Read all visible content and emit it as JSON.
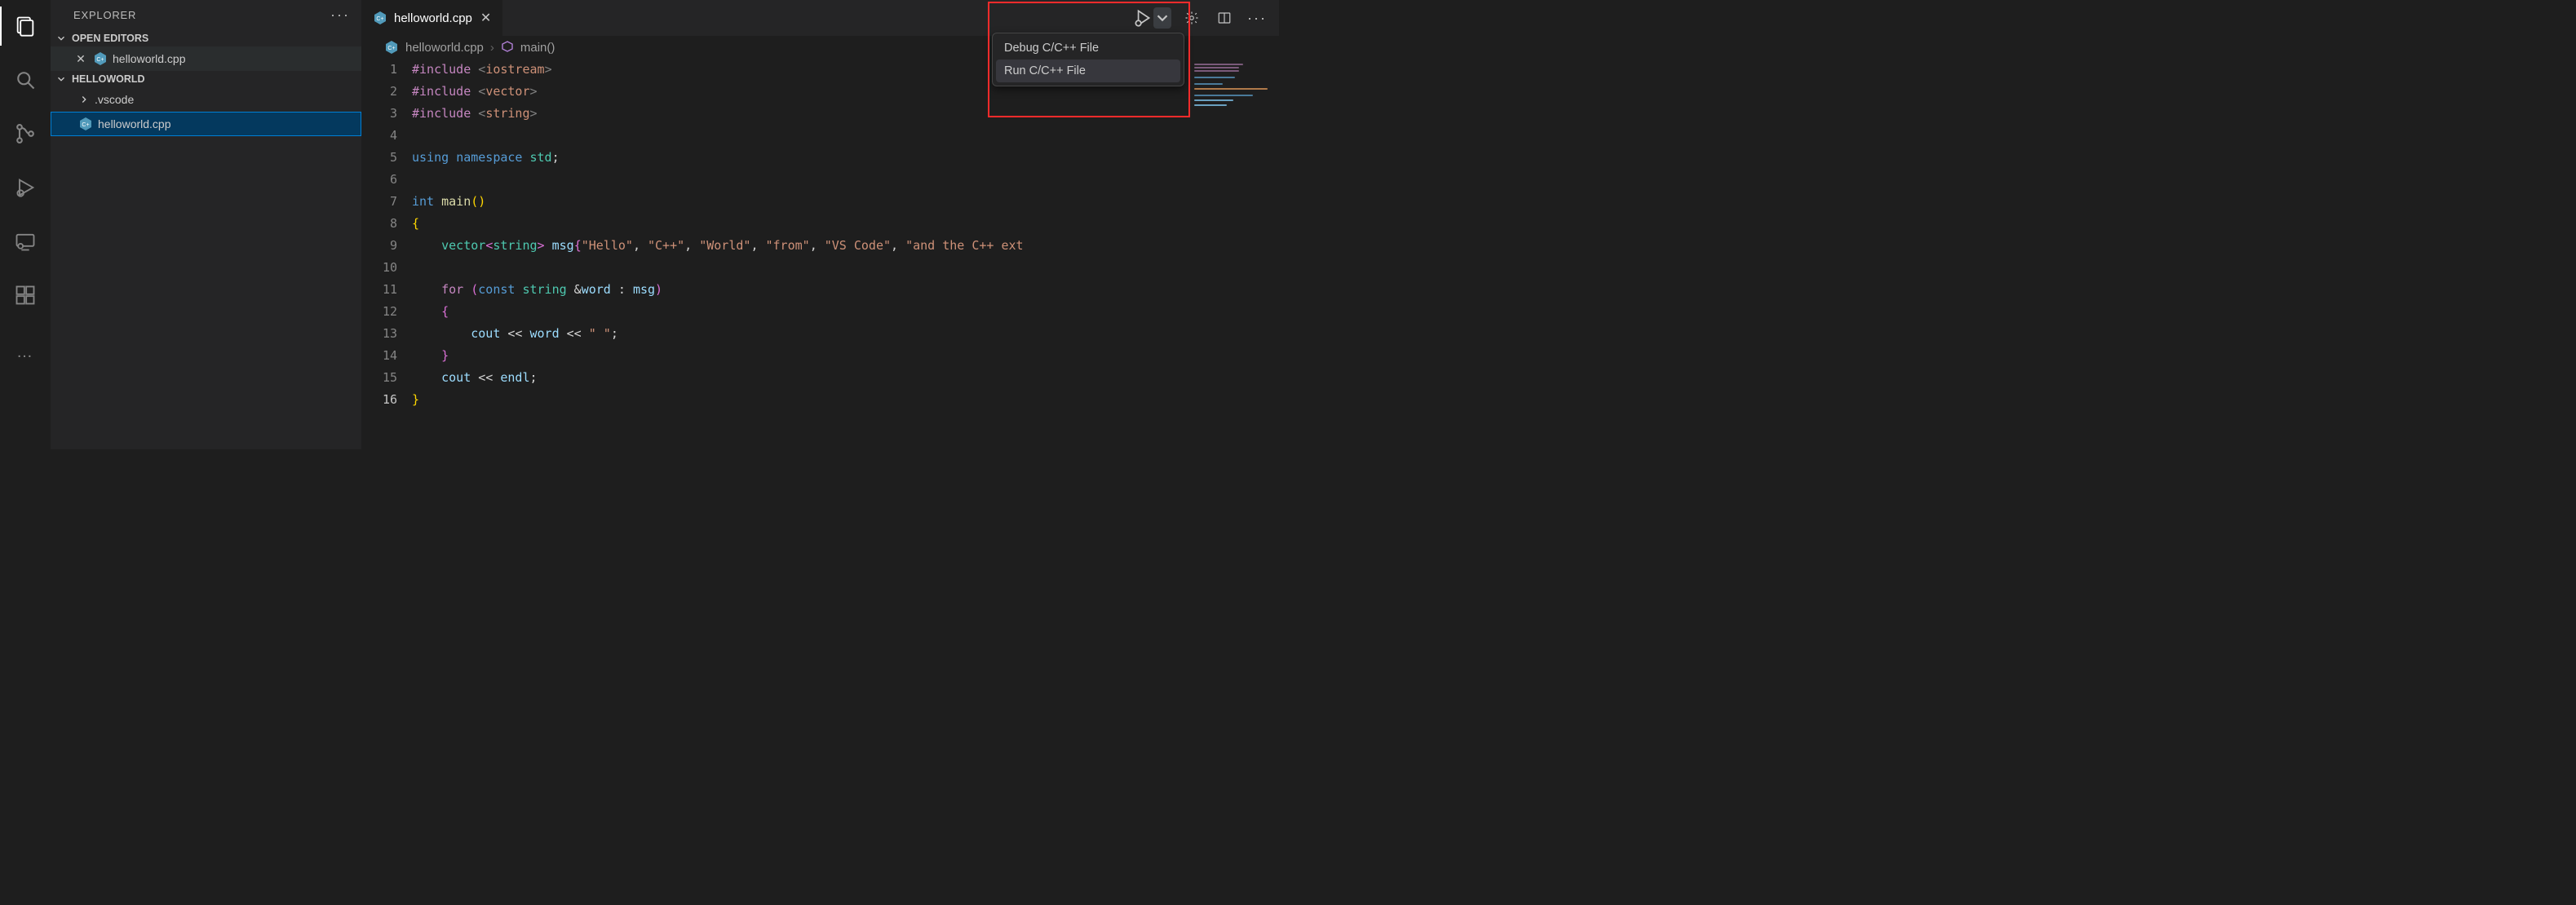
{
  "activity": {
    "items": [
      "explorer",
      "search",
      "source-control",
      "run-debug",
      "remote",
      "extensions"
    ],
    "overflow": "…"
  },
  "sidebar": {
    "title": "EXPLORER",
    "sections": {
      "openEditors": {
        "label": "OPEN EDITORS",
        "items": [
          {
            "name": "helloworld.cpp",
            "icon": "cpp"
          }
        ]
      },
      "workspace": {
        "label": "HELLOWORLD",
        "items": [
          {
            "type": "folder",
            "name": ".vscode"
          },
          {
            "type": "file",
            "name": "helloworld.cpp",
            "icon": "cpp",
            "selected": true
          }
        ]
      }
    },
    "more": "···"
  },
  "tabs": {
    "open": [
      {
        "name": "helloworld.cpp",
        "icon": "cpp",
        "active": true
      }
    ]
  },
  "runMenu": {
    "items": [
      {
        "label": "Debug C/C++ File"
      },
      {
        "label": "Run C/C++ File",
        "hover": true
      }
    ]
  },
  "breadcrumb": {
    "file": "helloworld.cpp",
    "symbol": "main()"
  },
  "code": {
    "lines": [
      [
        {
          "t": "tk-macro",
          "v": "#include"
        },
        {
          "t": "tk-punc",
          "v": " "
        },
        {
          "t": "tk-angle",
          "v": "<"
        },
        {
          "t": "tk-string",
          "v": "iostream"
        },
        {
          "t": "tk-angle",
          "v": ">"
        }
      ],
      [
        {
          "t": "tk-macro",
          "v": "#include"
        },
        {
          "t": "tk-punc",
          "v": " "
        },
        {
          "t": "tk-angle",
          "v": "<"
        },
        {
          "t": "tk-string",
          "v": "vector"
        },
        {
          "t": "tk-angle",
          "v": ">"
        }
      ],
      [
        {
          "t": "tk-macro",
          "v": "#include"
        },
        {
          "t": "tk-punc",
          "v": " "
        },
        {
          "t": "tk-angle",
          "v": "<"
        },
        {
          "t": "tk-string",
          "v": "string"
        },
        {
          "t": "tk-angle",
          "v": ">"
        }
      ],
      [],
      [
        {
          "t": "tk-keyword",
          "v": "using"
        },
        {
          "t": "tk-punc",
          "v": " "
        },
        {
          "t": "tk-keyword",
          "v": "namespace"
        },
        {
          "t": "tk-punc",
          "v": " "
        },
        {
          "t": "tk-type",
          "v": "std"
        },
        {
          "t": "tk-punc",
          "v": ";"
        }
      ],
      [],
      [
        {
          "t": "tk-keyword",
          "v": "int"
        },
        {
          "t": "tk-punc",
          "v": " "
        },
        {
          "t": "tk-func",
          "v": "main"
        },
        {
          "t": "tk-brace0",
          "v": "()"
        }
      ],
      [
        {
          "t": "tk-brace0",
          "v": "{"
        }
      ],
      [
        {
          "t": "tk-punc",
          "v": "    "
        },
        {
          "t": "tk-type",
          "v": "vector"
        },
        {
          "t": "tk-brace",
          "v": "<"
        },
        {
          "t": "tk-type",
          "v": "string"
        },
        {
          "t": "tk-brace",
          "v": ">"
        },
        {
          "t": "tk-punc",
          "v": " "
        },
        {
          "t": "tk-var",
          "v": "msg"
        },
        {
          "t": "tk-brace",
          "v": "{"
        },
        {
          "t": "tk-string",
          "v": "\"Hello\""
        },
        {
          "t": "tk-punc",
          "v": ", "
        },
        {
          "t": "tk-string",
          "v": "\"C++\""
        },
        {
          "t": "tk-punc",
          "v": ", "
        },
        {
          "t": "tk-string",
          "v": "\"World\""
        },
        {
          "t": "tk-punc",
          "v": ", "
        },
        {
          "t": "tk-string",
          "v": "\"from\""
        },
        {
          "t": "tk-punc",
          "v": ", "
        },
        {
          "t": "tk-string",
          "v": "\"VS Code\""
        },
        {
          "t": "tk-punc",
          "v": ", "
        },
        {
          "t": "tk-string",
          "v": "\"and the C++ ext"
        }
      ],
      [],
      [
        {
          "t": "tk-punc",
          "v": "    "
        },
        {
          "t": "tk-control",
          "v": "for"
        },
        {
          "t": "tk-punc",
          "v": " "
        },
        {
          "t": "tk-brace",
          "v": "("
        },
        {
          "t": "tk-keyword",
          "v": "const"
        },
        {
          "t": "tk-punc",
          "v": " "
        },
        {
          "t": "tk-type",
          "v": "string"
        },
        {
          "t": "tk-punc",
          "v": " &"
        },
        {
          "t": "tk-var",
          "v": "word"
        },
        {
          "t": "tk-punc",
          "v": " : "
        },
        {
          "t": "tk-var",
          "v": "msg"
        },
        {
          "t": "tk-brace",
          "v": ")"
        }
      ],
      [
        {
          "t": "tk-punc",
          "v": "    "
        },
        {
          "t": "tk-brace",
          "v": "{"
        }
      ],
      [
        {
          "t": "tk-punc",
          "v": "        "
        },
        {
          "t": "tk-var",
          "v": "cout"
        },
        {
          "t": "tk-punc",
          "v": " "
        },
        {
          "t": "tk-op",
          "v": "<<"
        },
        {
          "t": "tk-punc",
          "v": " "
        },
        {
          "t": "tk-var",
          "v": "word"
        },
        {
          "t": "tk-punc",
          "v": " "
        },
        {
          "t": "tk-op",
          "v": "<<"
        },
        {
          "t": "tk-punc",
          "v": " "
        },
        {
          "t": "tk-string",
          "v": "\" \""
        },
        {
          "t": "tk-punc",
          "v": ";"
        }
      ],
      [
        {
          "t": "tk-punc",
          "v": "    "
        },
        {
          "t": "tk-brace",
          "v": "}"
        }
      ],
      [
        {
          "t": "tk-punc",
          "v": "    "
        },
        {
          "t": "tk-var",
          "v": "cout"
        },
        {
          "t": "tk-punc",
          "v": " "
        },
        {
          "t": "tk-op",
          "v": "<<"
        },
        {
          "t": "tk-punc",
          "v": " "
        },
        {
          "t": "tk-var",
          "v": "endl"
        },
        {
          "t": "tk-punc",
          "v": ";"
        }
      ],
      [
        {
          "t": "tk-brace0",
          "v": "}"
        }
      ]
    ],
    "currentLine": 16
  },
  "colors": {
    "accent": "#007fd4",
    "highlight": "#ff2b2b"
  }
}
